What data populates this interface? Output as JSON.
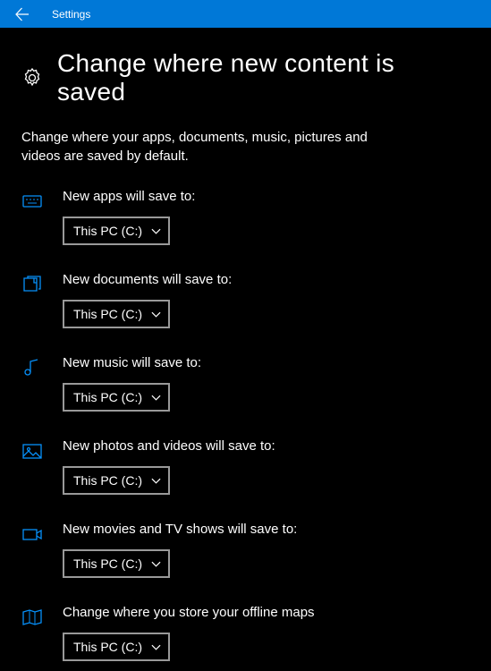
{
  "titlebar": {
    "title": "Settings"
  },
  "header": {
    "title": "Change where new content is saved"
  },
  "description": "Change where your apps, documents, music, pictures and videos are saved by default.",
  "settings": {
    "apps": {
      "label": "New apps will save to:",
      "value": "This PC (C:)"
    },
    "documents": {
      "label": "New documents will save to:",
      "value": "This PC (C:)"
    },
    "music": {
      "label": "New music will save to:",
      "value": "This PC (C:)"
    },
    "photos": {
      "label": "New photos and videos will save to:",
      "value": "This PC (C:)"
    },
    "movies": {
      "label": "New movies and TV shows will save to:",
      "value": "This PC (C:)"
    },
    "maps": {
      "label": "Change where you store your offline maps",
      "value": "This PC (C:)"
    }
  }
}
